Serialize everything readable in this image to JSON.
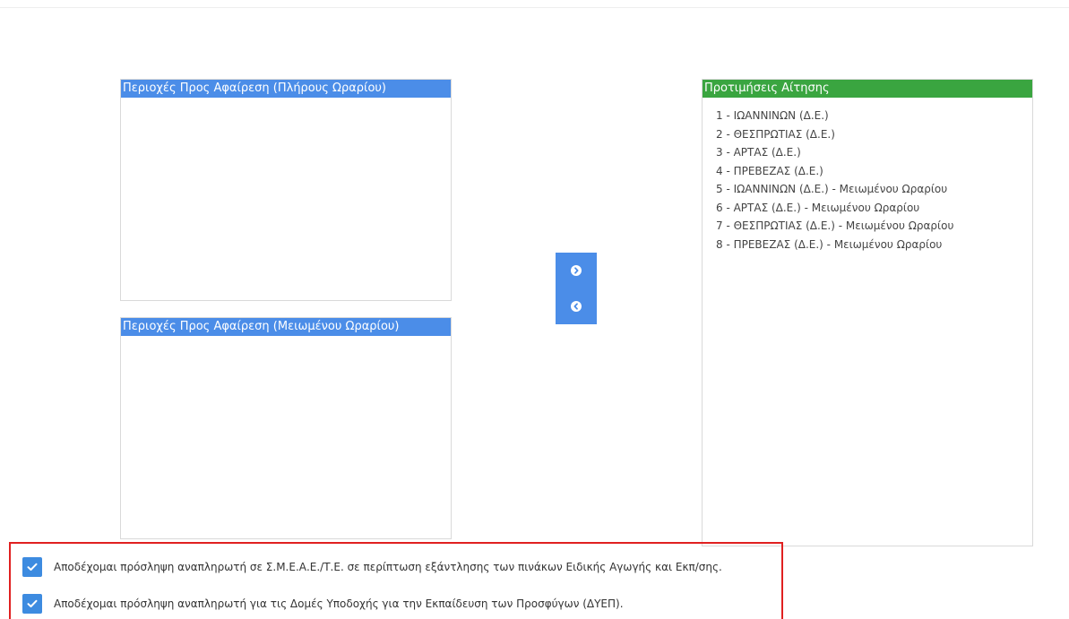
{
  "panels": {
    "full_hours": {
      "title": "Περιοχές Προς Αφαίρεση (Πλήρους Ωραρίου)",
      "items": []
    },
    "reduced_hours": {
      "title": "Περιοχές Προς Αφαίρεση (Μειωμένου Ωραρίου)",
      "items": []
    },
    "preferences": {
      "title": "Προτιμήσεις Αίτησης",
      "items": [
        "1 - ΙΩΑΝΝΙΝΩΝ (Δ.Ε.)",
        "2 - ΘΕΣΠΡΩΤΙΑΣ (Δ.Ε.)",
        "3 - ΑΡΤΑΣ (Δ.Ε.)",
        "4 - ΠΡΕΒΕΖΑΣ (Δ.Ε.)",
        "5 - ΙΩΑΝΝΙΝΩΝ (Δ.Ε.) - Μειωμένου Ωραρίου",
        "6 - ΑΡΤΑΣ (Δ.Ε.) - Μειωμένου Ωραρίου",
        "7 - ΘΕΣΠΡΩΤΙΑΣ (Δ.Ε.) - Μειωμένου Ωραρίου",
        "8 - ΠΡΕΒΕΖΑΣ (Δ.Ε.) - Μειωμένου Ωραρίου"
      ]
    }
  },
  "mover": {
    "right_icon": "chevron-circle-right-icon",
    "left_icon": "chevron-circle-left-icon"
  },
  "consents": [
    {
      "checked": true,
      "label": "Αποδέχομαι πρόσληψη αναπληρωτή σε Σ.Μ.Ε.Α.Ε./Τ.Ε. σε περίπτωση εξάντλησης των πινάκων Ειδικής Αγωγής και Εκπ/σης."
    },
    {
      "checked": true,
      "label": "Αποδέχομαι πρόσληψη αναπληρωτή για τις Δομές Υποδοχής για την Εκπαίδευση των Προσφύγων (ΔΥΕΠ)."
    }
  ],
  "colors": {
    "blue_header": "#4b8de8",
    "green_header": "#3aa540",
    "checkbox": "#3d8be0",
    "highlight_border": "#e02020"
  }
}
